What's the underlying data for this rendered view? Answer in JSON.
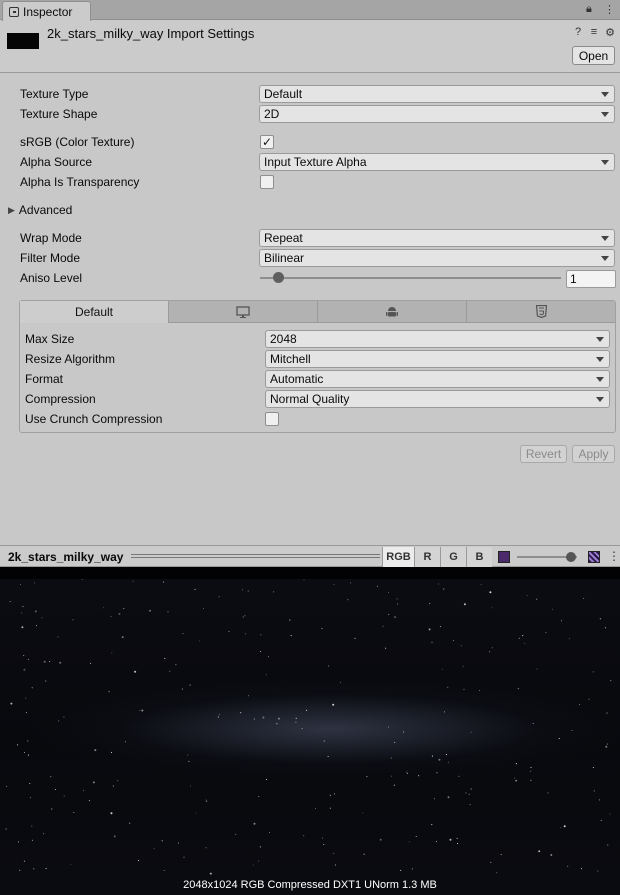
{
  "window": {
    "tab_label": "Inspector",
    "lock_icon": "lock-icon",
    "menu_icon": "kebab-icon"
  },
  "header": {
    "title": "2k_stars_milky_way Import Settings",
    "open_label": "Open",
    "icons": [
      "help-icon",
      "preset-icon",
      "gear-icon"
    ]
  },
  "fields": {
    "texture_type": {
      "label": "Texture Type",
      "value": "Default"
    },
    "texture_shape": {
      "label": "Texture Shape",
      "value": "2D"
    },
    "srgb": {
      "label": "sRGB (Color Texture)",
      "checked": true,
      "mark": "✓"
    },
    "alpha_source": {
      "label": "Alpha Source",
      "value": "Input Texture Alpha"
    },
    "alpha_transparency": {
      "label": "Alpha Is Transparency",
      "checked": false
    },
    "advanced": {
      "label": "Advanced",
      "expanded": false
    },
    "wrap_mode": {
      "label": "Wrap Mode",
      "value": "Repeat"
    },
    "filter_mode": {
      "label": "Filter Mode",
      "value": "Bilinear"
    },
    "aniso_level": {
      "label": "Aniso Level",
      "value": "1",
      "slider_fraction": 0.06
    }
  },
  "platform": {
    "tabs": [
      {
        "label": "Default",
        "icon": "",
        "active": true
      },
      {
        "label": "",
        "icon": "monitor-icon",
        "active": false
      },
      {
        "label": "",
        "icon": "android-icon",
        "active": false
      },
      {
        "label": "",
        "icon": "html5-icon",
        "active": false
      }
    ],
    "max_size": {
      "label": "Max Size",
      "value": "2048"
    },
    "resize_algorithm": {
      "label": "Resize Algorithm",
      "value": "Mitchell"
    },
    "format": {
      "label": "Format",
      "value": "Automatic"
    },
    "compression": {
      "label": "Compression",
      "value": "Normal Quality"
    },
    "crunch": {
      "label": "Use Crunch Compression",
      "checked": false
    }
  },
  "actions": {
    "revert_label": "Revert",
    "apply_label": "Apply"
  },
  "preview": {
    "title": "2k_stars_milky_way",
    "channels": [
      "RGB",
      "R",
      "G",
      "B"
    ],
    "active_channel": "RGB",
    "mip_level_fraction": 0.9,
    "info": "2048x1024  RGB Compressed DXT1 UNorm   1.3 MB"
  }
}
